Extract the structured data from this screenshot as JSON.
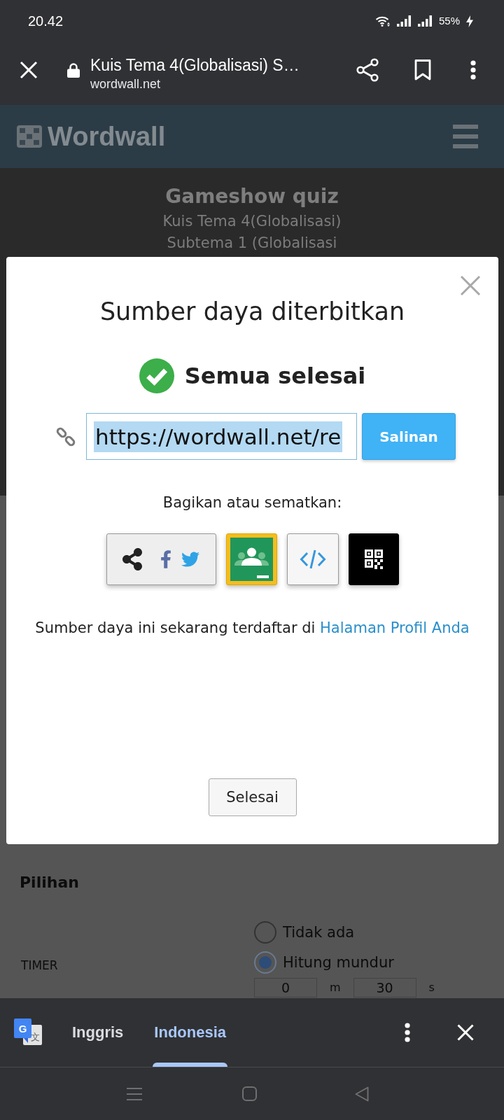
{
  "status_bar": {
    "time": "20.42",
    "battery": "55%"
  },
  "browser_toolbar": {
    "title": "Kuis Tema 4(Globalisasi) S…",
    "url": "wordwall.net"
  },
  "site_header": {
    "logo": "Wordwall"
  },
  "page": {
    "activity_type": "Gameshow quiz",
    "activity_title": "Kuis Tema 4(Globalisasi) Subtema 1 (Globalisasi",
    "options": {
      "heading": "Pilihan",
      "timer_label": "TIMER",
      "timer_choices": [
        {
          "label": "Tidak ada",
          "selected": false
        },
        {
          "label": "Hitung mundur",
          "selected": true
        }
      ],
      "time_fields": [
        {
          "value": "0",
          "unit": "m"
        },
        {
          "value": "30",
          "unit": "s"
        }
      ]
    }
  },
  "dialog": {
    "title": "Sumber daya diterbitkan",
    "status": "Semua selesai",
    "url_field": {
      "value": "https://wordwall.net/re",
      "text_selected": true
    },
    "copy_button": "Salinan",
    "share_prompt": "Bagikan atau sematkan:",
    "share_buttons": [
      {
        "kind": "social"
      },
      {
        "kind": "classroom"
      },
      {
        "kind": "embed"
      },
      {
        "kind": "qr"
      }
    ],
    "profile_note": {
      "text": "Sumber daya ini sekarang terdaftar di",
      "link": "Halaman Profil Anda"
    },
    "done_button": "Selesai"
  },
  "translate_bar": {
    "icon_letters": [
      "G",
      "文"
    ],
    "languages": [
      {
        "label": "Inggris",
        "selected": false
      },
      {
        "label": "Indonesia",
        "selected": true
      }
    ]
  }
}
